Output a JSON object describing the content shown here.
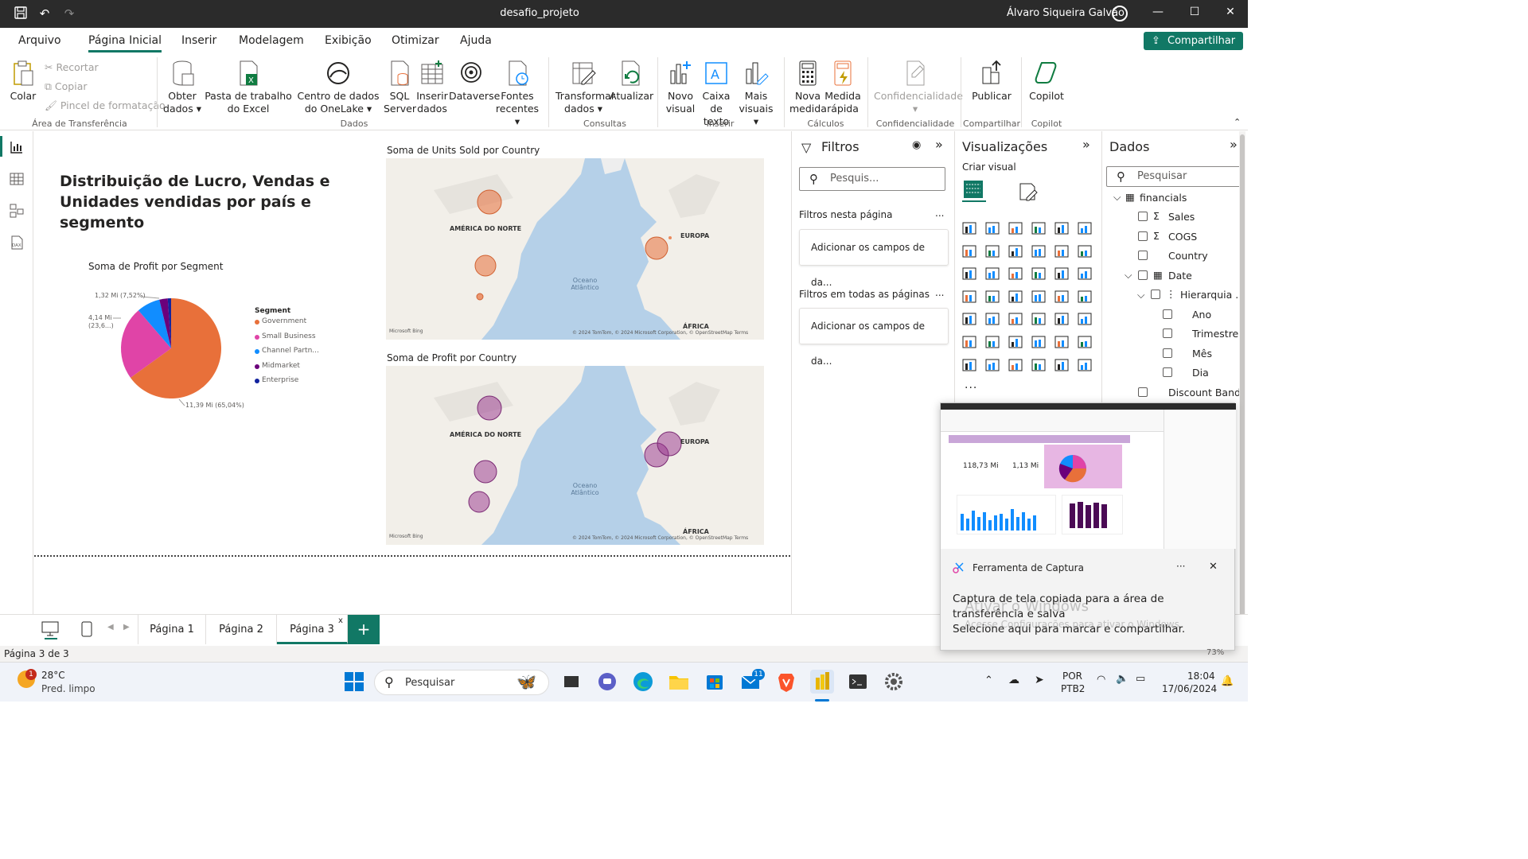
{
  "titlebar": {
    "doc_title": "desafio_projeto",
    "user": "Álvaro Siqueira Galvão"
  },
  "menu": {
    "items": [
      "Arquivo",
      "Página Inicial",
      "Inserir",
      "Modelagem",
      "Exibição",
      "Otimizar",
      "Ajuda"
    ],
    "share": "Compartilhar"
  },
  "ribbon": {
    "colar": "Colar",
    "recortar": "Recortar",
    "copiar": "Copiar",
    "pincel": "Pincel de formatação",
    "grp_transfer": "Área de Transferência",
    "obter": "Obter dados",
    "excel": "Pasta de trabalho do Excel",
    "onelake": "Centro de dados do OneLake",
    "sql": "SQL Server",
    "inserir_dados": "Inserir dados",
    "dataverse": "Dataverse",
    "fontes": "Fontes recentes",
    "grp_dados": "Dados",
    "transformar": "Transformar dados",
    "atualizar": "Atualizar",
    "grp_consultas": "Consultas",
    "novo_visual": "Novo visual",
    "caixa_texto": "Caixa de texto",
    "mais_visuais": "Mais visuais",
    "grp_inserir": "Inserir",
    "nova_medida": "Nova medida",
    "medida_rapida": "Medida rápida",
    "grp_calculos": "Cálculos",
    "confidencialidade": "Confidencialidade",
    "grp_conf": "Confidencialidade",
    "publicar": "Publicar",
    "grp_compartilhar": "Compartilhar",
    "copilot": "Copilot",
    "grp_copilot": "Copilot"
  },
  "report": {
    "title": "Distribuição de Lucro, Vendas e Unidades vendidas por país e segmento",
    "pie_title": "Soma de Profit por Segment",
    "map1_title": "Soma de Units Sold por Country",
    "map2_title": "Soma de Profit por Country",
    "map_labels": {
      "na": "AMÉRICA DO NORTE",
      "eu": "EUROPA",
      "af": "ÁFRICA",
      "ocean": "Oceano Atlântico",
      "bing": "Microsoft Bing",
      "attr": "© 2024 TomTom, © 2024 Microsoft Corporation, © OpenStreetMap Terms"
    }
  },
  "chart_data": {
    "type": "pie",
    "title": "Soma de Profit por Segment",
    "legend_title": "Segment",
    "legend_placement": "right",
    "categories": [
      "Government",
      "Small Business",
      "Channel Partn...",
      "Midmarket",
      "Enterprise"
    ],
    "values": [
      11.39,
      4.14,
      1.32,
      0.47,
      0.19
    ],
    "percent": [
      65.04,
      23.6,
      7.52,
      2.7,
      1.1
    ],
    "data_labels": [
      "11,39 Mi (65,04%)",
      "4,14 Mi (23,6...)",
      "1,32 Mi (7,52%)"
    ],
    "colors": [
      "#e8703a",
      "#e044a7",
      "#118dff",
      "#6b007b",
      "#12239e"
    ]
  },
  "pages": {
    "tabs": [
      "Página 1",
      "Página 2",
      "Página 3"
    ],
    "active": "Página 3",
    "status": "Página 3 de 3"
  },
  "filters": {
    "title": "Filtros",
    "search": "Pesquis...",
    "this_page": "Filtros nesta página",
    "all_pages": "Filtros em todas as páginas",
    "add_fields": "Adicionar os campos de da...",
    "more": "..."
  },
  "visualizations": {
    "title": "Visualizações",
    "build": "Criar visual",
    "more": "..."
  },
  "data_pane": {
    "title": "Dados",
    "search": "Pesquisar",
    "table": "financials",
    "fields": [
      "Sales",
      "COGS",
      "Country",
      "Date",
      "Hierarquia ...",
      "Ano",
      "Trimestre",
      "Mês",
      "Dia",
      "Discount Band"
    ],
    "zoom": "73%"
  },
  "toast": {
    "app": "Ferramenta de Captura",
    "message": "Captura de tela copiada para a área de transferência e salva",
    "sub": "Selecione aqui para marcar e compartilhar.",
    "thumb_v1": "118,73 Mi",
    "thumb_v2": "1,13 Mi",
    "watermark1": "Ativar o Windows",
    "watermark2": "Acesse Configurações para ativar o Windows."
  },
  "taskbar": {
    "weather_temp": "28°C",
    "weather_desc": "Pred. limpo",
    "weather_badge": "1",
    "search": "Pesquisar",
    "lang1": "POR",
    "lang2": "PTB2",
    "time": "18:04",
    "date": "17/06/2024",
    "mail_badge": "11"
  }
}
